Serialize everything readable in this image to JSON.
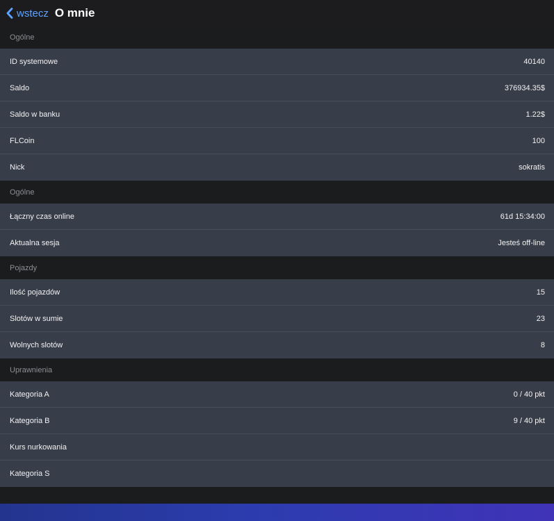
{
  "navbar": {
    "back_label": "wstecz",
    "title": "O mnie"
  },
  "sections": [
    {
      "header": "Ogólne",
      "rows": [
        {
          "label": "ID systemowe",
          "value": "40140"
        },
        {
          "label": "Saldo",
          "value": "376934.35$"
        },
        {
          "label": "Saldo w banku",
          "value": "1.22$"
        },
        {
          "label": "FLCoin",
          "value": "100"
        },
        {
          "label": "Nick",
          "value": "sokratis"
        }
      ]
    },
    {
      "header": "Ogólne",
      "rows": [
        {
          "label": "Łączny czas online",
          "value": "61d 15:34:00"
        },
        {
          "label": "Aktualna sesja",
          "value": "Jesteś off-line"
        }
      ]
    },
    {
      "header": "Pojazdy",
      "rows": [
        {
          "label": "Ilość pojazdów",
          "value": "15"
        },
        {
          "label": "Slotów w sumie",
          "value": "23"
        },
        {
          "label": "Wolnych slotów",
          "value": "8"
        }
      ]
    },
    {
      "header": "Uprawnienia",
      "rows": [
        {
          "label": "Kategoria A",
          "value": "0 / 40 pkt"
        },
        {
          "label": "Kategoria B",
          "value": "9 / 40 pkt"
        },
        {
          "label": "Kurs nurkowania",
          "value": ""
        },
        {
          "label": "Kategoria S",
          "value": ""
        }
      ]
    }
  ],
  "colors": {
    "accent": "#5ea3ff",
    "row_background": "#383d4a",
    "page_background": "#1b1c1e",
    "section_header_text": "#8e8e93",
    "bottom_bar": "#2c3cae"
  },
  "icons": {
    "back": "chevron-left-icon"
  }
}
